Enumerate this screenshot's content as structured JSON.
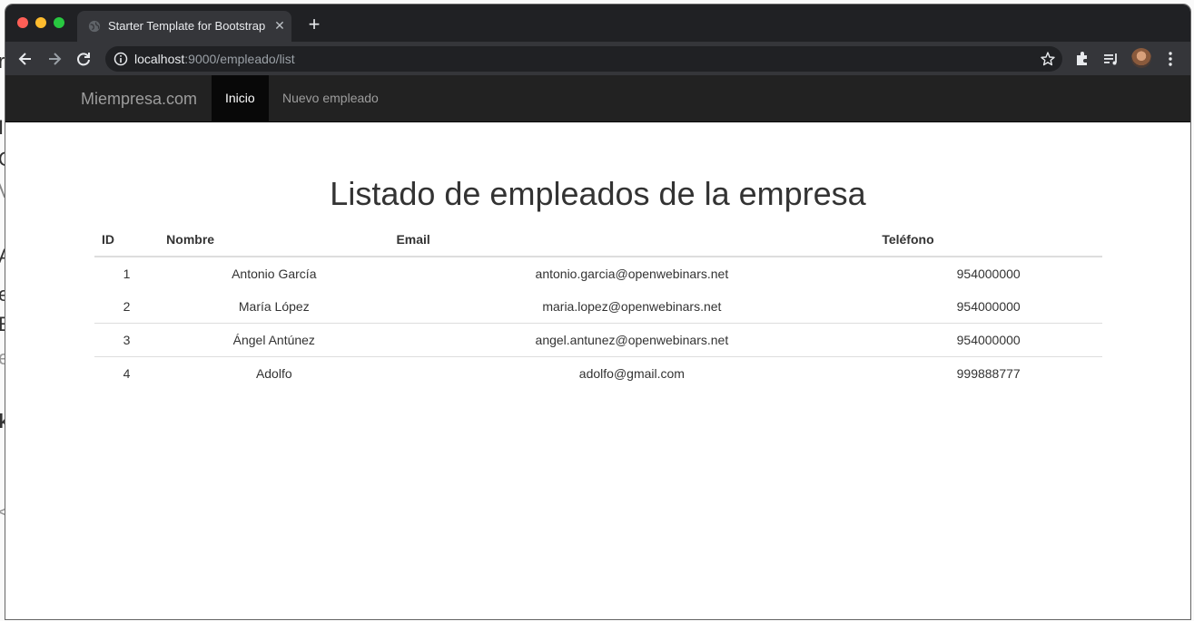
{
  "browser": {
    "tab_title": "Starter Template for Bootstrap",
    "tab_close": "✕",
    "new_tab": "+",
    "url_host": "localhost",
    "url_rest": ":9000/empleado/list"
  },
  "navbar": {
    "brand": "Miempresa.com",
    "items": [
      {
        "label": "Inicio",
        "active": true
      },
      {
        "label": "Nuevo empleado",
        "active": false
      }
    ]
  },
  "main": {
    "title": "Listado de empleados de la empresa",
    "table": {
      "headers": [
        "ID",
        "Nombre",
        "Email",
        "Teléfono"
      ],
      "rows": [
        [
          "1",
          "Antonio García",
          "antonio.garcia@openwebinars.net",
          "954000000"
        ],
        [
          "2",
          "María López",
          "maria.lopez@openwebinars.net",
          "954000000"
        ],
        [
          "3",
          "Ángel Antúnez",
          "angel.antunez@openwebinars.net",
          "954000000"
        ],
        [
          "4",
          "Adolfo",
          "adolfo@gmail.com",
          "999888777"
        ]
      ]
    }
  },
  "desktop_fragments": [
    "r",
    "I",
    "C",
    "V",
    "A",
    "e",
    "E",
    "e",
    "k",
    "<"
  ],
  "colors": {
    "navbar_bg": "#222222",
    "navbar_active_bg": "#080808",
    "navbar_text": "#9d9d9d",
    "chrome_titlebar": "#202124",
    "chrome_toolbar": "#35363a"
  }
}
